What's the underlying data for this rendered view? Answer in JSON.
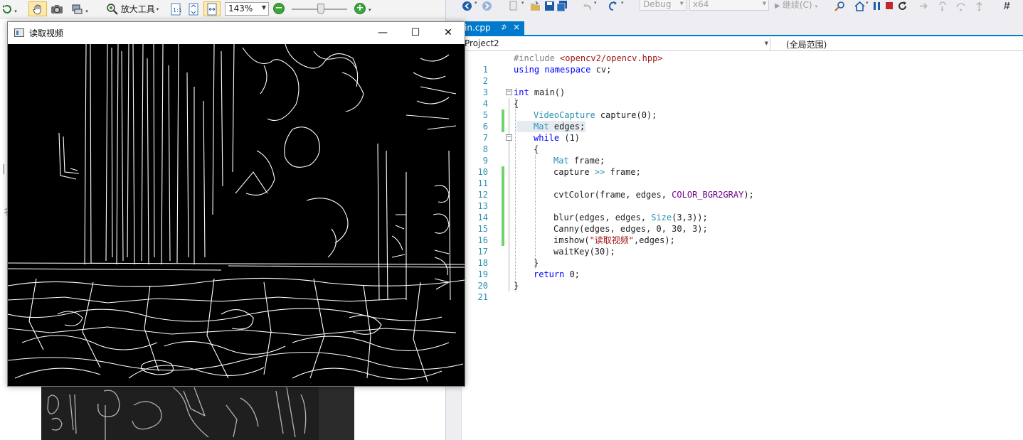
{
  "viewer": {
    "toolbar": {
      "magnifier_label": "放大工具",
      "zoom_value": "143%",
      "icons": [
        "refresh-icon",
        "hand-pan-icon",
        "camera-icon",
        "scan-icon",
        "magnifier-icon",
        "actual-size-icon",
        "fit-window-icon",
        "fit-page-icon",
        "zoom-out-icon",
        "zoom-in-icon"
      ]
    }
  },
  "ide": {
    "toolbar": {
      "config": "Debug",
      "platform": "x64",
      "continue_label": "继续(C)"
    },
    "tab": {
      "title": "in.cpp",
      "pin": "⊅",
      "close": "×"
    },
    "navbar": {
      "project": "Project2",
      "scope": "(全局范围)"
    },
    "code_lines": [
      {
        "n": "1"
      },
      {
        "n": "2"
      },
      {
        "n": "3"
      },
      {
        "n": "4"
      },
      {
        "n": "5"
      },
      {
        "n": "6"
      },
      {
        "n": "7"
      },
      {
        "n": "8"
      },
      {
        "n": "9"
      },
      {
        "n": "10"
      },
      {
        "n": "11"
      },
      {
        "n": "12"
      },
      {
        "n": "13"
      },
      {
        "n": "14"
      },
      {
        "n": "15"
      },
      {
        "n": "16"
      },
      {
        "n": "17"
      },
      {
        "n": "18"
      },
      {
        "n": "19"
      },
      {
        "n": "20"
      },
      {
        "n": "21"
      }
    ],
    "code": {
      "l1_pp": "#include ",
      "l1_s": "<opencv2/opencv.hpp>",
      "l2_k1": "using",
      "l2_k2": "namespace",
      "l2_d": " cv;",
      "l4_k": "int",
      "l4_d": " main()",
      "l5": "{",
      "l6_t": "VideoCapture",
      "l6_d": " capture(0);",
      "l7_t": "Mat",
      "l7_d": " edges;",
      "l8_k": "while",
      "l8_d": " (1)",
      "l9": "{",
      "l10_t": "Mat",
      "l10_d": " frame;",
      "l11_d1": "capture ",
      "l11_o": ">>",
      "l11_d2": " frame;",
      "l13_d": "cvtColor(frame, edges, ",
      "l13_m": "COLOR_BGR2GRAY",
      "l13_e": ");",
      "l15_d": "blur(edges, edges, ",
      "l15_t": "Size",
      "l15_e": "(3,3));",
      "l16": "Canny(edges, edges, 0, 30, 3);",
      "l17_d": "imshow(",
      "l17_s": "\"读取视频\"",
      "l17_e": ",edges);",
      "l18": "waitKey(30);",
      "l19": "}",
      "l20_k": "return",
      "l20_d": " 0;",
      "l21": "}"
    }
  },
  "cv_window": {
    "title": "读取视频",
    "minimize": "—",
    "maximize": "☐",
    "close": "✕"
  }
}
